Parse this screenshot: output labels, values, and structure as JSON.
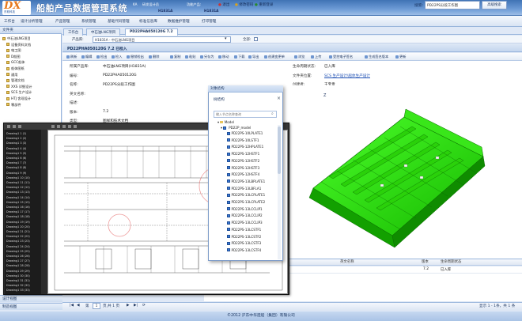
{
  "header": {
    "logo_mark": "DX",
    "logo_sub": "东软科技",
    "title": "船舶产品数据管理系统",
    "user_code_label": "KA",
    "user_name": "研发设计员",
    "user_value": "H1831A",
    "role_label": "功能产品:",
    "role_value": "H1831A",
    "logout": "退出",
    "change_pwd": "修改密码",
    "relogin": "重新登录"
  },
  "menu": {
    "items": [
      "工作台",
      "设计分析管理",
      "产品管理",
      "系统管理",
      "基础代码管理",
      "标准信息库",
      "数据维护管理",
      "打印管理"
    ],
    "search_label": "搜索:",
    "search_value": "PD22PS分段工作图",
    "search_button": "高级搜索"
  },
  "sidebar": {
    "header": "文件夹",
    "items": [
      {
        "label": "中石油LNG项目",
        "indent": 0,
        "selected": false
      },
      {
        "label": "设备资料文档",
        "indent": 1,
        "selected": false
      },
      {
        "label": "电工图",
        "indent": 1,
        "selected": false
      },
      {
        "label": "D船图",
        "indent": 1,
        "selected": false
      },
      {
        "label": "GCC船体",
        "indent": 1,
        "selected": false
      },
      {
        "label": "船体图纸",
        "indent": 1,
        "selected": false
      },
      {
        "label": "通用",
        "indent": 1,
        "selected": false
      },
      {
        "label": "管理文档",
        "indent": 1,
        "selected": false
      },
      {
        "label": "XXS 详细设计",
        "indent": 1,
        "selected": false
      },
      {
        "label": "SCS 生产设计",
        "indent": 1,
        "selected": false
      },
      {
        "label": "HTJ 舍现设计",
        "indent": 1,
        "selected": false
      },
      {
        "label": "零部件",
        "indent": 1,
        "selected": false
      }
    ],
    "accordion_1": "设计视图",
    "accordion_2": "制造视图"
  },
  "tabs": [
    {
      "label": "工作台",
      "active": false
    },
    {
      "label": "中石油LNG项目",
      "active": false
    },
    {
      "label": "PD22PHA050120G 7.2",
      "active": true
    }
  ],
  "product_row": {
    "label": "产品库:",
    "value": "H1831A - 中石油LNG项目",
    "all_label": "全部:"
  },
  "document": {
    "title": "PD22PHA050120G 7.2 已检入"
  },
  "toolbar": {
    "buttons": [
      "刷新",
      "编辑",
      "检出",
      "检入",
      "撤销检出",
      "删除",
      "复制",
      "粘贴",
      "另存为",
      "移动",
      "下载",
      "导出",
      "创建变更单",
      "浏览",
      "上传",
      "受控电子签名",
      "生成签名版本",
      "更新"
    ]
  },
  "properties": {
    "left": [
      {
        "label": "所属产品库:",
        "value": "中石油LNG项目(H1831A)"
      },
      {
        "label": "编号:",
        "value": "PD22PHA050120G"
      },
      {
        "label": "名称:",
        "value": "PD22PS分段工作图"
      },
      {
        "label": "英文名称:",
        "value": ""
      },
      {
        "label": "描述:",
        "value": ""
      },
      {
        "label": "版本:",
        "value": "7.2"
      },
      {
        "label": "类型:",
        "value": "图样和技术文档"
      }
    ],
    "right": [
      {
        "label": "生命周期状态:",
        "value": "已入库",
        "link": false
      },
      {
        "label": "文件夹位置:",
        "value": "SCS 生产设计\\船体生产设计",
        "link": true
      },
      {
        "label": "创建者:",
        "value": "王宝贵",
        "link": false
      }
    ]
  },
  "grid": {
    "headers": [
      "英文名称",
      "版本",
      "生命周期状态"
    ],
    "rows": [
      {
        "name": "分段工作图",
        "version": "7.2",
        "status": "已入库"
      }
    ]
  },
  "pager": {
    "page_label": "第",
    "page": "1",
    "page_total": "页,共 1 页",
    "summary": "显示 1 - 1条，共 1 条"
  },
  "footer": "©2012 沪东中华造船（集团）有限公司",
  "viewer": {
    "list_items": [
      "Drawing1 1 (1)",
      "Drawing1 2 (2)",
      "Drawing1 3 (3)",
      "Drawing1 4 (4)",
      "Drawing1 5 (5)",
      "Drawing1 6 (6)",
      "Drawing1 7 (7)",
      "Drawing1 8 (8)",
      "Drawing1 9 (9)",
      "Drawing1 10 (10)",
      "Drawing1 11 (11)",
      "Drawing1 12 (12)",
      "Drawing1 13 (13)",
      "Drawing1 14 (14)",
      "Drawing1 15 (15)",
      "Drawing1 16 (16)",
      "Drawing1 17 (17)",
      "Drawing1 18 (18)",
      "Drawing1 19 (19)",
      "Drawing1 20 (20)",
      "Drawing1 21 (21)",
      "Drawing1 22 (22)",
      "Drawing1 23 (23)",
      "Drawing1 24 (24)",
      "Drawing1 25 (25)",
      "Drawing1 26 (26)",
      "Drawing1 27 (27)",
      "Drawing1 28 (28)",
      "Drawing1 29 (29)",
      "Drawing1 30 (30)",
      "Drawing1 31 (31)",
      "Drawing1 32 (32)",
      "Drawing1 33 (33)"
    ]
  },
  "dialog": {
    "titlebar": "对象结构",
    "title": "树结构",
    "search_placeholder": "输入节点名称查询",
    "root": "Model",
    "node": "PD22P_model",
    "children": [
      "PD22PS-10LPLATE1",
      "PD22PS-10LSTF1",
      "PD22PS-12HPLATE1",
      "PD22PS-12HSTF1",
      "PD22PS-12HSTF2",
      "PD22PS-12HSTF3",
      "PD22PS-12HSTF4",
      "PD22PS-13LBPLATE1",
      "PD22PS-13LBFLA1",
      "PD22PS-13LCPLATE1",
      "PD22PS-13LCPLATE2",
      "PD22PS-13LCCLIP1",
      "PD22PS-13LCCLIP2",
      "PD22PS-13LCCLIP3",
      "PD22PS-13LCSTF1",
      "PD22PS-13LCSTF2",
      "PD22PS-13LCSTF3",
      "PD22PS-13LCSTF4"
    ]
  },
  "colors": {
    "header_blue": "#3f73b5",
    "model_green": "#22e000",
    "link_blue": "#1d4fb3"
  }
}
